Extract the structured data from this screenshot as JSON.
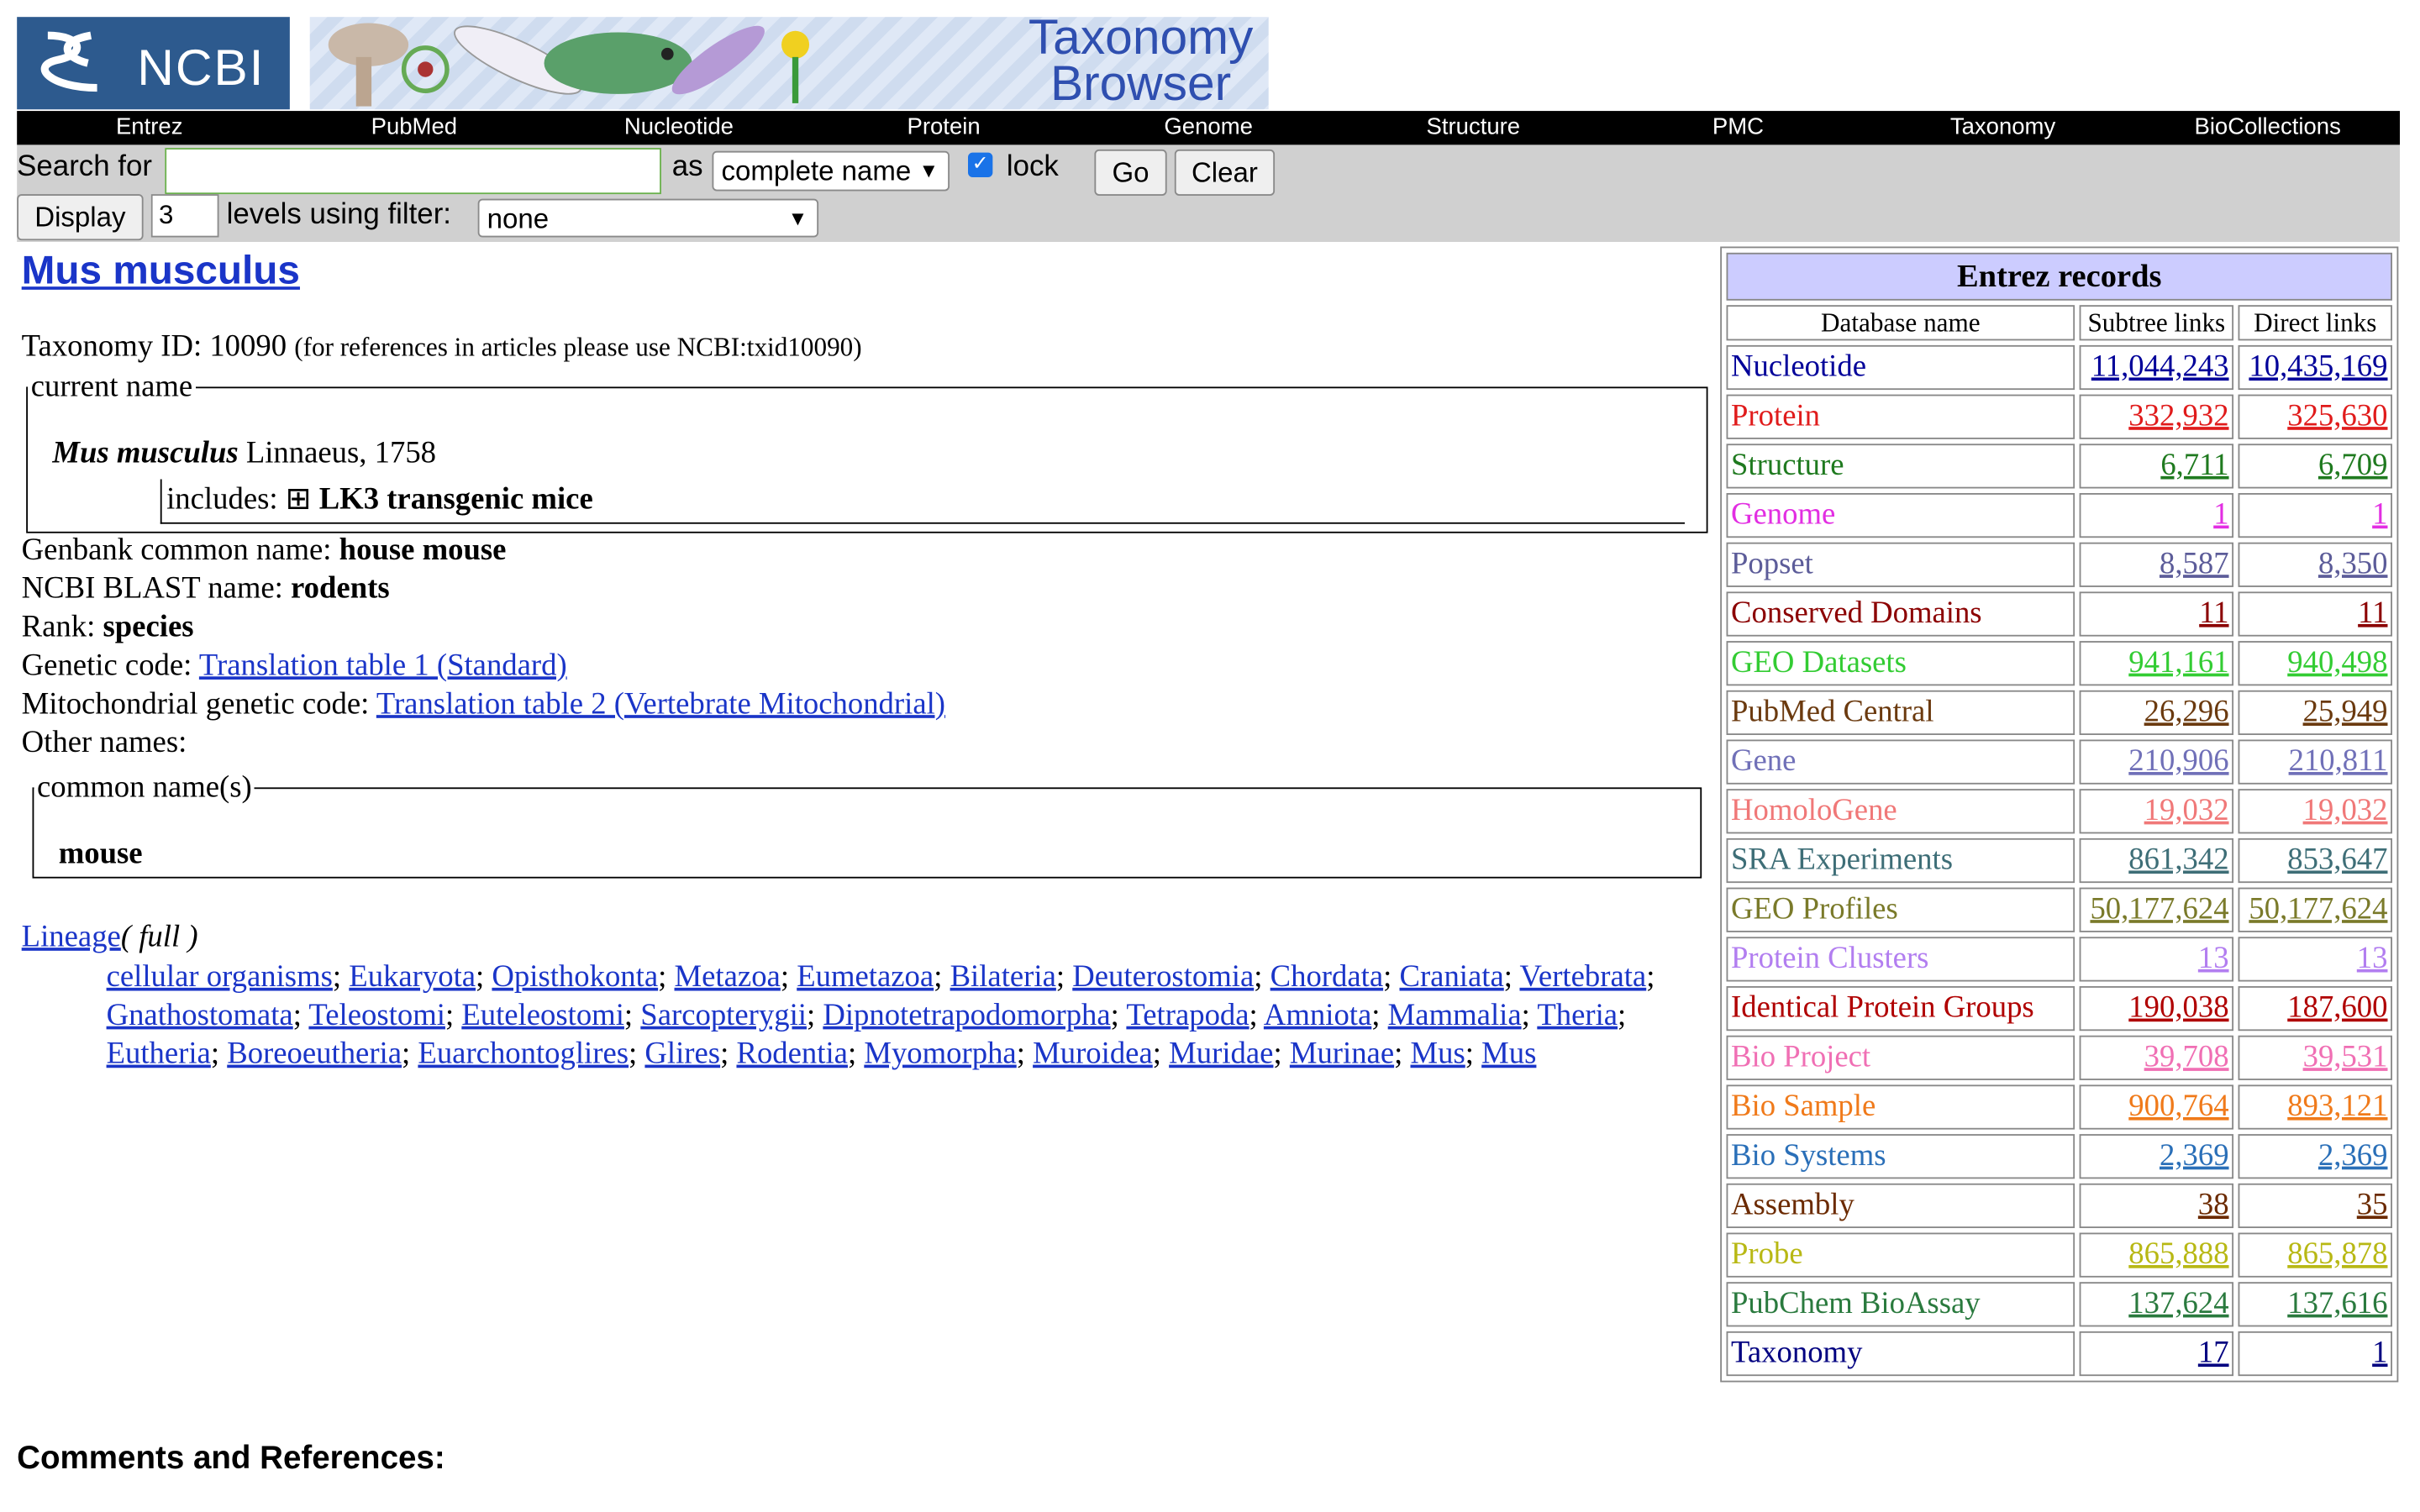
{
  "header": {
    "ncbi_logo": "NCBI",
    "banner_title_1": "Taxonomy",
    "banner_title_2": "Browser"
  },
  "nav": [
    "Entrez",
    "PubMed",
    "Nucleotide",
    "Protein",
    "Genome",
    "Structure",
    "PMC",
    "Taxonomy",
    "BioCollections"
  ],
  "search": {
    "label": "Search for",
    "value": "",
    "as_label": "as",
    "mode": "complete name",
    "lock_checked": true,
    "lock_label": "lock",
    "go": "Go",
    "clear": "Clear",
    "display_button": "Display",
    "levels": "3",
    "levels_label": "levels using filter:",
    "filter": "none"
  },
  "taxon": {
    "title": "Mus musculus",
    "taxonomy_id_label": "Taxonomy ID:",
    "taxonomy_id": "10090",
    "ref_note": "(for references in articles please use NCBI:txid10090)",
    "current_name_legend": "current name",
    "scientific_name": "Mus musculus",
    "authority": "Linnaeus, 1758",
    "includes_label": "includes:",
    "includes_icon": "⊞",
    "includes_value": "LK3 transgenic mice",
    "genbank_label": "Genbank common name:",
    "genbank_value": "house mouse",
    "blast_label": "NCBI BLAST name:",
    "blast_value": "rodents",
    "rank_label": "Rank:",
    "rank_value": "species",
    "genetic_code_label": "Genetic code:",
    "genetic_code_link": "Translation table 1 (Standard)",
    "mito_code_label": "Mitochondrial genetic code:",
    "mito_code_link": "Translation table 2 (Vertebrate Mitochondrial)",
    "other_names_label": "Other names:",
    "common_names_legend": "common name(s)",
    "common_name": "mouse"
  },
  "lineage": {
    "label": "Lineage",
    "full": "( full )",
    "items": [
      "cellular organisms",
      "Eukaryota",
      "Opisthokonta",
      "Metazoa",
      "Eumetazoa",
      "Bilateria",
      "Deuterostomia",
      "Chordata",
      "Craniata",
      "Vertebrata",
      "Gnathostomata",
      "Teleostomi",
      "Euteleostomi",
      "Sarcopterygii",
      "Dipnotetrapodomorpha",
      "Tetrapoda",
      "Amniota",
      "Mammalia",
      "Theria",
      "Eutheria",
      "Boreoeutheria",
      "Euarchontoglires",
      "Glires",
      "Rodentia",
      "Myomorpha",
      "Muroidea",
      "Muridae",
      "Murinae",
      "Mus",
      "Mus"
    ]
  },
  "entrez": {
    "title": "Entrez records",
    "headers": [
      "Database name",
      "Subtree links",
      "Direct links"
    ],
    "rows": [
      {
        "name": "Nucleotide",
        "subtree": "11,044,243",
        "direct": "10,435,169",
        "color": "#000099"
      },
      {
        "name": "Protein",
        "subtree": "332,932",
        "direct": "325,630",
        "color": "#e01b1b"
      },
      {
        "name": "Structure",
        "subtree": "6,711",
        "direct": "6,709",
        "color": "#1f7a1f"
      },
      {
        "name": "Genome",
        "subtree": "1",
        "direct": "1",
        "color": "#e22ee2"
      },
      {
        "name": "Popset",
        "subtree": "8,587",
        "direct": "8,350",
        "color": "#5c5c99"
      },
      {
        "name": "Conserved Domains",
        "subtree": "11",
        "direct": "11",
        "color": "#8b0000"
      },
      {
        "name": "GEO Datasets",
        "subtree": "941,161",
        "direct": "940,498",
        "color": "#33cc33"
      },
      {
        "name": "PubMed Central",
        "subtree": "26,296",
        "direct": "25,949",
        "color": "#6b3a0f"
      },
      {
        "name": "Gene",
        "subtree": "210,906",
        "direct": "210,811",
        "color": "#7070b8"
      },
      {
        "name": "HomoloGene",
        "subtree": "19,032",
        "direct": "19,032",
        "color": "#f07878"
      },
      {
        "name": "SRA Experiments",
        "subtree": "861,342",
        "direct": "853,647",
        "color": "#3e6e77"
      },
      {
        "name": "GEO Profiles",
        "subtree": "50,177,624",
        "direct": "50,177,624",
        "color": "#7a7a2a"
      },
      {
        "name": "Protein Clusters",
        "subtree": "13",
        "direct": "13",
        "color": "#b27ef0"
      },
      {
        "name": "Identical Protein Groups",
        "subtree": "190,038",
        "direct": "187,600",
        "color": "#b00000"
      },
      {
        "name": "Bio Project",
        "subtree": "39,708",
        "direct": "39,531",
        "color": "#f06fb4"
      },
      {
        "name": "Bio Sample",
        "subtree": "900,764",
        "direct": "893,121",
        "color": "#f07a1a"
      },
      {
        "name": "Bio Systems",
        "subtree": "2,369",
        "direct": "2,369",
        "color": "#2a6fb8"
      },
      {
        "name": "Assembly",
        "subtree": "38",
        "direct": "35",
        "color": "#6b2a00"
      },
      {
        "name": "Probe",
        "subtree": "865,888",
        "direct": "865,878",
        "color": "#b8b814"
      },
      {
        "name": "PubChem BioAssay",
        "subtree": "137,624",
        "direct": "137,616",
        "color": "#2a7a3e"
      },
      {
        "name": "Taxonomy",
        "subtree": "17",
        "direct": "1",
        "color": "#000080"
      }
    ]
  },
  "comments_heading": "Comments and References:"
}
